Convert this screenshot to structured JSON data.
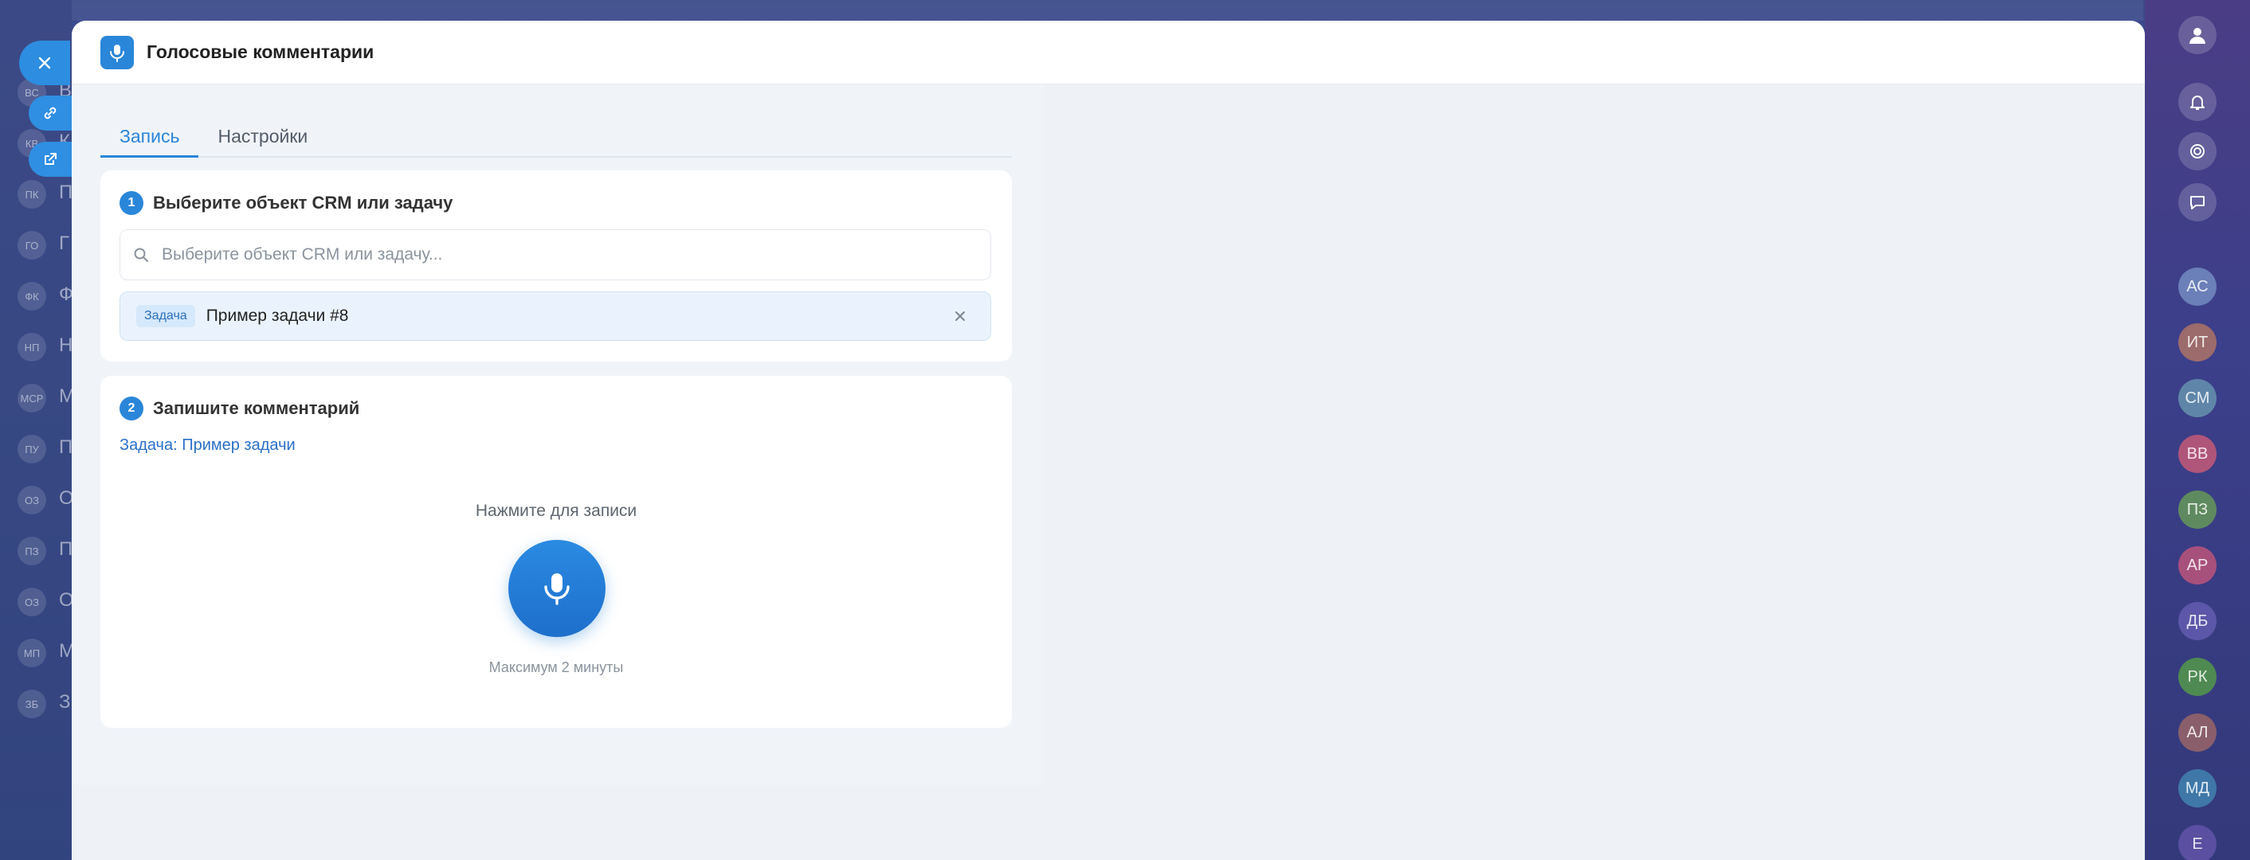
{
  "modal": {
    "title": "Голосовые комментарии",
    "tabs": [
      {
        "label": "Запись",
        "active": true
      },
      {
        "label": "Настройки",
        "active": false
      }
    ]
  },
  "step1": {
    "number": "1",
    "title": "Выберите объект CRM или задачу",
    "search_placeholder": "Выберите объект CRM или задачу...",
    "selected": {
      "badge": "Задача",
      "text": "Пример задачи #8"
    }
  },
  "step2": {
    "number": "2",
    "title": "Запишите комментарий",
    "target_link": "Задача: Пример задачи",
    "record_hint": "Нажмите для записи",
    "record_max": "Максимум 2 минуты"
  },
  "bg_left": {
    "items": [
      {
        "initials": "ВС",
        "label": "В"
      },
      {
        "initials": "КВ",
        "label": "К"
      },
      {
        "initials": "ПК",
        "label": "П"
      },
      {
        "initials": "ГО",
        "label": "Г"
      },
      {
        "initials": "ФК",
        "label": "Ф"
      },
      {
        "initials": "НП",
        "label": "Н"
      },
      {
        "initials": "МСР",
        "label": "М"
      },
      {
        "initials": "ПУ",
        "label": "П"
      },
      {
        "initials": "ОЗ",
        "label": "О"
      },
      {
        "initials": "ПЗ",
        "label": "П"
      },
      {
        "initials": "ОЗ",
        "label": "О"
      },
      {
        "initials": "МП",
        "label": "М"
      },
      {
        "initials": "ЗБ",
        "label": "З"
      }
    ]
  },
  "rail": {
    "avatars": [
      {
        "initials": "АС",
        "color": "#6b7fb8"
      },
      {
        "initials": "ИТ",
        "color": "#9c6b6b"
      },
      {
        "initials": "СМ",
        "color": "#5f86a8"
      },
      {
        "initials": "ВВ",
        "color": "#b0557a"
      },
      {
        "initials": "ПЗ",
        "color": "#5f8a5f"
      },
      {
        "initials": "АР",
        "color": "#a8507c"
      },
      {
        "initials": "ДБ",
        "color": "#5c57a8"
      },
      {
        "initials": "РК",
        "color": "#4f8a52"
      },
      {
        "initials": "АЛ",
        "color": "#8a5f6b"
      },
      {
        "initials": "МД",
        "color": "#3f78a8"
      },
      {
        "initials": "Е",
        "color": "#5a4fa0"
      }
    ]
  },
  "colors": {
    "accent": "#2a86d9",
    "link": "#2a70c8"
  }
}
